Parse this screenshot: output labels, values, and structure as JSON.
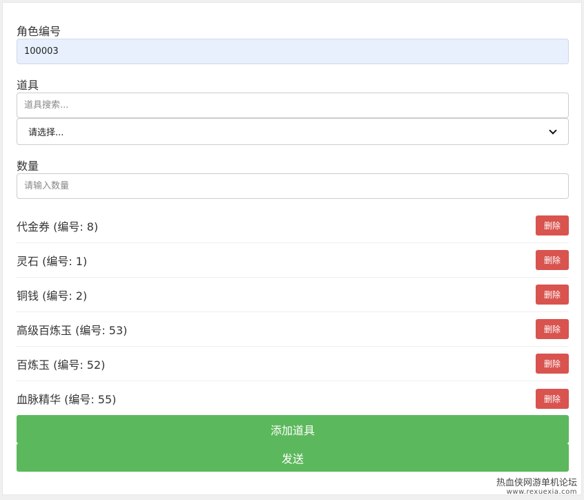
{
  "form": {
    "role_label": "角色编号",
    "role_value": "100003",
    "item_label": "道具",
    "item_search_placeholder": "道具搜索...",
    "item_select_value": "请选择...",
    "quantity_label": "数量",
    "quantity_placeholder": "请输入数量"
  },
  "items": [
    {
      "text": "代金券 (编号: 8)",
      "delete_label": "删除"
    },
    {
      "text": "灵石 (编号: 1)",
      "delete_label": "删除"
    },
    {
      "text": "铜钱 (编号: 2)",
      "delete_label": "删除"
    },
    {
      "text": "高级百炼玉 (编号: 53)",
      "delete_label": "删除"
    },
    {
      "text": "百炼玉 (编号: 52)",
      "delete_label": "删除"
    },
    {
      "text": "血脉精华 (编号: 55)",
      "delete_label": "删除"
    }
  ],
  "actions": {
    "add_label": "添加道具",
    "send_label": "发送"
  },
  "watermark": {
    "name": "热血侠网游单机论坛",
    "url": "www.rexuexia.com"
  },
  "colors": {
    "delete_button": "#d9534f",
    "primary_button": "#5cb85c",
    "autofill_background": "#e8f0fe"
  }
}
